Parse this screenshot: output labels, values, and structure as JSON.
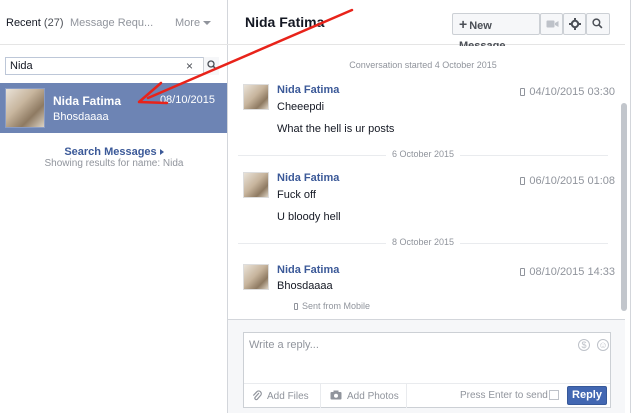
{
  "left_panel": {
    "tab_recent": "Recent",
    "recent_count": "(27)",
    "tab_requests": "Message Requ...",
    "tab_more": "More",
    "search_value": "Nida",
    "thread": {
      "name": "Nida Fatima",
      "snippet": "Bhosdaaaa",
      "date": "08/10/2015"
    },
    "search_messages_link": "Search Messages",
    "search_note": "Showing results for name: Nida"
  },
  "header": {
    "title": "Nida Fatima",
    "new_message_label": "New Message"
  },
  "conversation": {
    "started_label": "Conversation started 4 October 2015",
    "messages": [
      {
        "name": "Nida Fatima",
        "time": "04/10/2015 03:30",
        "lines": [
          "Cheeepdi",
          "What the hell is ur posts"
        ]
      },
      {
        "divider": "6 October 2015",
        "name": "Nida Fatima",
        "time": "06/10/2015 01:08",
        "lines": [
          "Fuck off",
          "U bloody hell"
        ]
      },
      {
        "divider": "8 October 2015",
        "name": "Nida Fatima",
        "time": "08/10/2015 14:33",
        "lines": [
          "Bhosdaaaa"
        ],
        "footer": "Sent from Mobile"
      }
    ]
  },
  "composer": {
    "placeholder": "Write a reply...",
    "add_files": "Add Files",
    "add_photos": "Add Photos",
    "press_enter": "Press Enter to send",
    "reply_label": "Reply"
  },
  "colors": {
    "selected_thread_bg": "#6d84b4",
    "link_blue": "#3b5998",
    "reply_button": "#4267b2",
    "annotation_arrow": "#e8231a"
  }
}
